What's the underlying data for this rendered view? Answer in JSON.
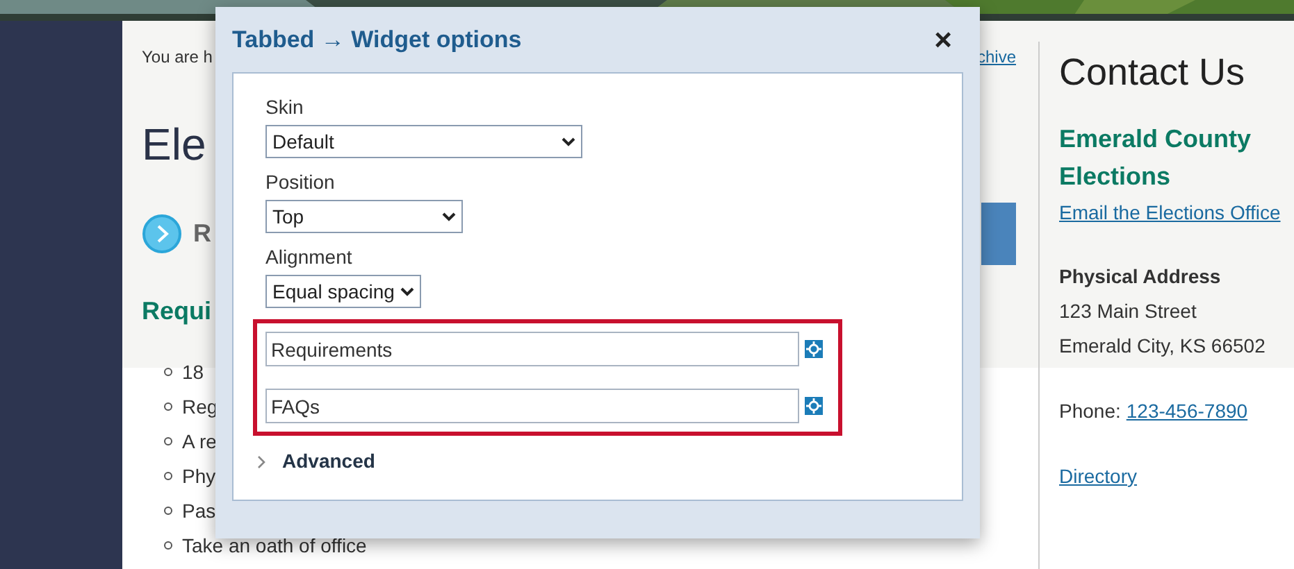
{
  "page": {
    "breadcrumb": "You are h",
    "breadcrumb_link": "chive",
    "title": "Ele",
    "section_link": "R",
    "heading": "Requi",
    "list": [
      "18",
      "Reg",
      "A re",
      "Phy",
      "Pas",
      "Take an oath of office"
    ]
  },
  "contact": {
    "title": "Contact Us",
    "org": "Emerald County Elections",
    "email_link": "Email the Elections Office",
    "address_label": "Physical Address",
    "address_lines": [
      "123 Main Street",
      "Emerald City, KS 66502"
    ],
    "phone_label": "Phone:",
    "phone": "123-456-7890",
    "directory_link": "Directory"
  },
  "dialog": {
    "title": "Tabbed → Widget options",
    "close": "×",
    "fields": [
      {
        "label": "Skin",
        "value": "Default"
      },
      {
        "label": "Position",
        "value": "Top"
      },
      {
        "label": "Alignment",
        "value": "Equal spacing"
      }
    ],
    "tabs": [
      {
        "value": "Requirements"
      },
      {
        "value": "FAQs"
      }
    ],
    "advanced": {
      "label": "Advanced",
      "expanded": false
    }
  }
}
